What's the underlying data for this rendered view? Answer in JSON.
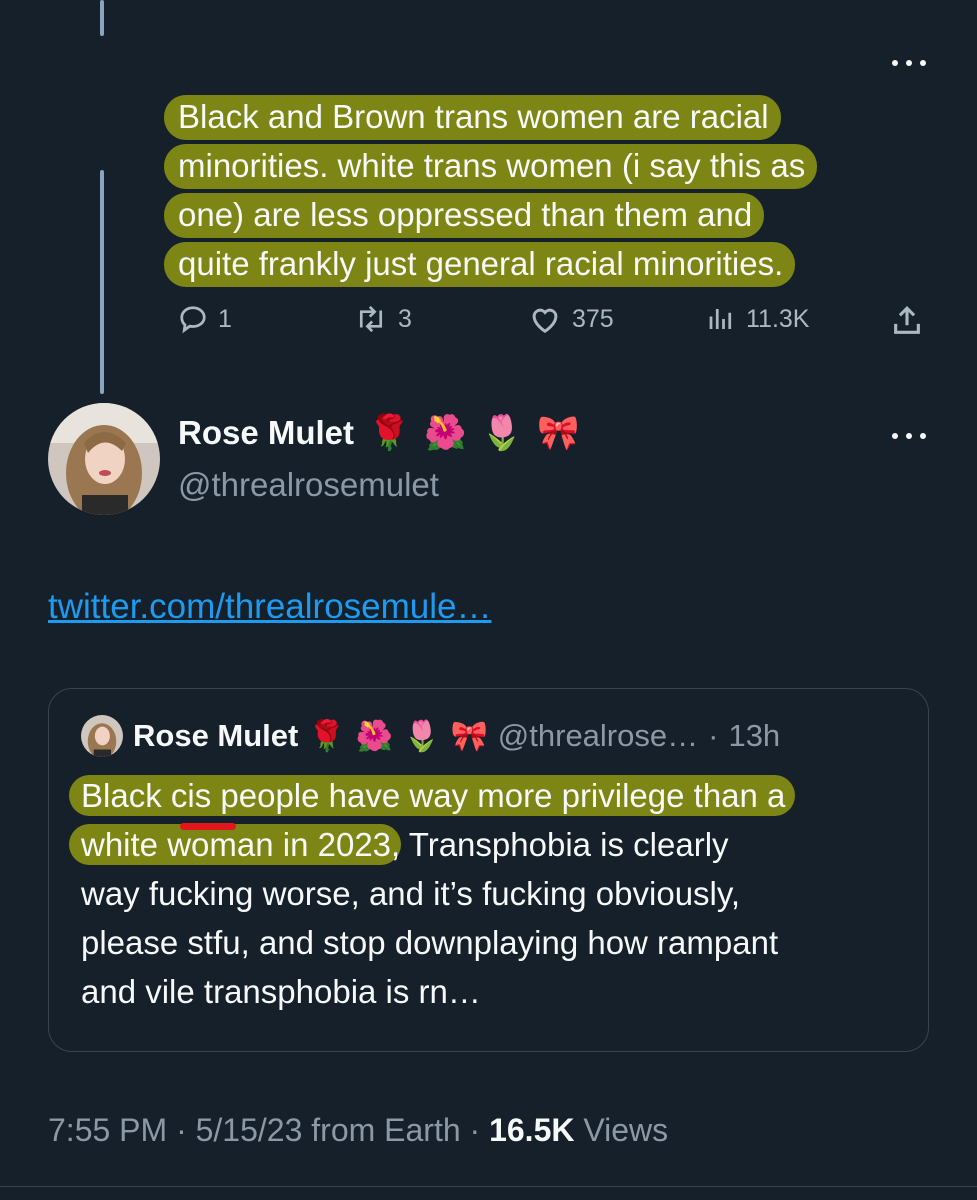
{
  "reply_tweet": {
    "text_lines": [
      "Black and Brown trans women are racial",
      "minorities. white trans women (i say this as",
      "one) are less oppressed than them and",
      "quite frankly just general racial minorities."
    ],
    "actions": {
      "replies": "1",
      "retweets": "3",
      "likes": "375",
      "views": "11.3K"
    }
  },
  "main_tweet": {
    "author_name": "Rose Mulet",
    "author_emojis": [
      "🌹",
      "🌺",
      "🌷",
      "🎀"
    ],
    "handle": "@threalrosemulet",
    "link_text": "twitter.com/threalrosemule…",
    "quoted_tweet": {
      "author_name": "Rose Mulet",
      "handle_truncated": "@threalrose…",
      "separator": "·",
      "time_ago": "13h",
      "highlight_line1_a": "Black ",
      "highlight_cis": "cis",
      "highlight_line1_b": " people have way more privilege than a",
      "highlight_line2": "white woman in 2023",
      "rest_line2": ", Transphobia is clearly",
      "line3": "way fucking worse, and it’s fucking obviously,",
      "line4": "please stfu, and stop downplaying how rampant",
      "line5": "and vile transphobia is rn…"
    },
    "footer": {
      "time": "7:55 PM",
      "date_and_source": "5/15/23 from Earth",
      "views_count": "16.5K",
      "views_label": "Views"
    }
  },
  "colors": {
    "background": "#15202b",
    "highlight": "#7d8614",
    "link": "#1d9bf0",
    "underline_mark": "#e0181b"
  },
  "icons": [
    "reply-icon",
    "retweet-icon",
    "like-icon",
    "views-icon",
    "share-icon",
    "more-icon"
  ]
}
